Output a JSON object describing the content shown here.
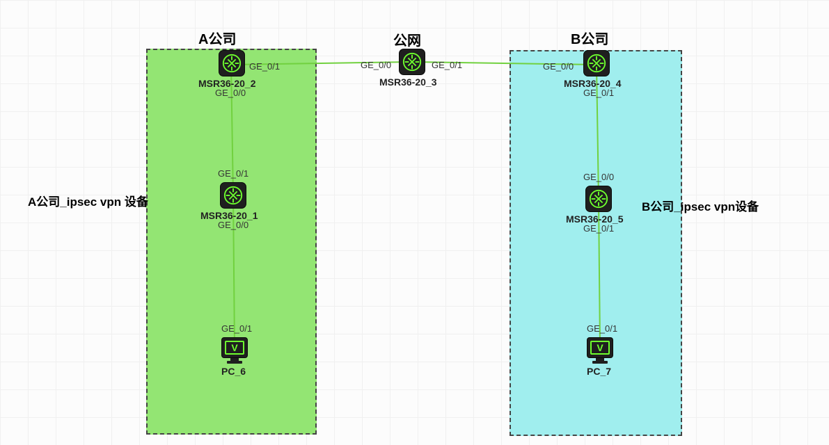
{
  "titles": {
    "companyA": "A公司",
    "public": "公网",
    "companyB": "B公司",
    "vpnA": "A公司_ipsec vpn 设备",
    "vpnB": "B公司_ipsec vpn设备"
  },
  "devices": {
    "r2": "MSR36-20_2",
    "r3": "MSR36-20_3",
    "r4": "MSR36-20_4",
    "r1": "MSR36-20_1",
    "r5": "MSR36-20_5",
    "pc6": "PC_6",
    "pc7": "PC_7"
  },
  "ports": {
    "r2_ge01": "GE_0/1",
    "r2_ge00": "GE_0/0",
    "r3_ge00": "GE_0/0",
    "r3_ge01": "GE_0/1",
    "r4_ge00": "GE_0/0",
    "r4_ge01": "GE_0/1",
    "r1_ge01": "GE_0/1",
    "r1_ge00": "GE_0/0",
    "r5_ge00": "GE_0/0",
    "r5_ge01": "GE_0/1",
    "pc6_ge01": "GE_0/1",
    "pc7_ge01": "GE_0/1"
  },
  "colors": {
    "zoneA": "#93e573",
    "zoneB": "#a0eeee",
    "link": "#71d13f"
  }
}
